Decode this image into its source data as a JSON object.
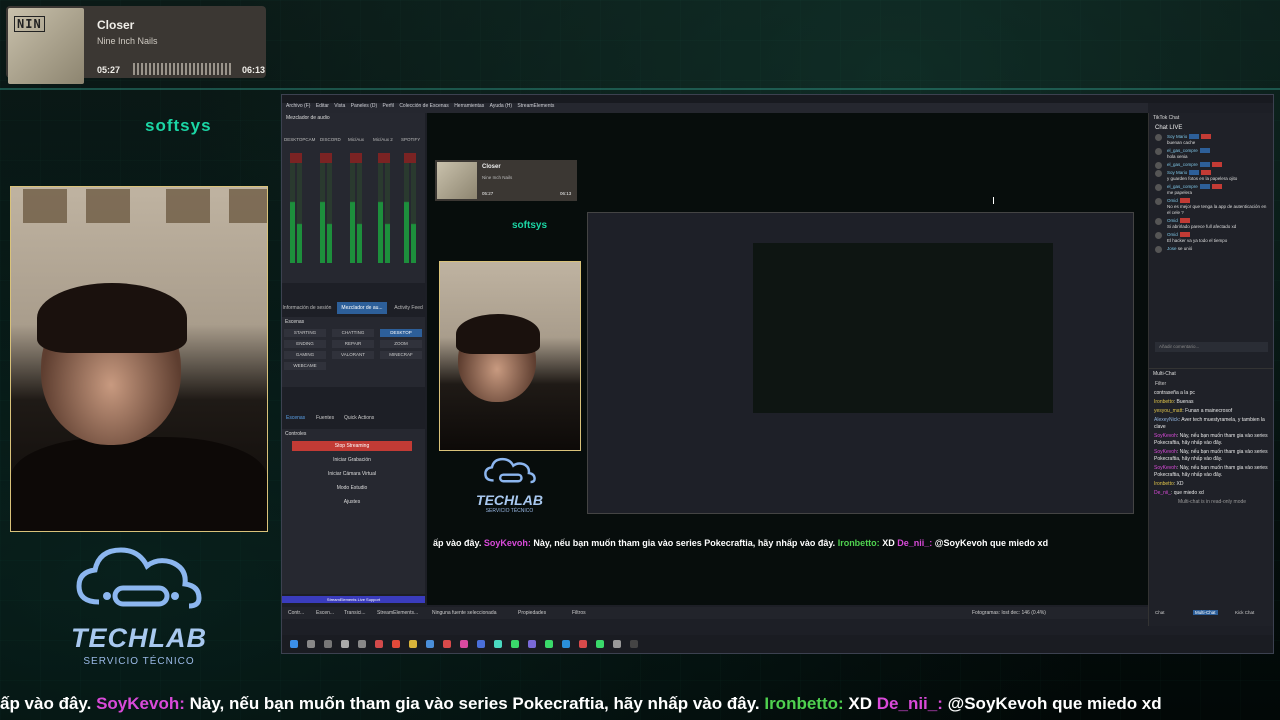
{
  "now_playing": {
    "album_art_logo": "NIN",
    "title": "Closer",
    "artist": "Nine Inch Nails",
    "elapsed": "05:27",
    "duration": "06:13"
  },
  "overlay": {
    "softsys": "softsys",
    "brand_name": "TECHLAB",
    "brand_sub": "SERVICIO TÉCNICO"
  },
  "obs": {
    "menu": [
      "Archivo (F)",
      "Editar",
      "Vista",
      "Paneles (D)",
      "Perfil",
      "Colección de Escenas",
      "Herramientas",
      "Ayuda (H)",
      "StreamElements"
    ],
    "mixer_title": "Mezclador de audio",
    "mixer_channels": [
      "DESKTOPCAM",
      "DISCORD",
      "Mic/Aux",
      "Mic/Aux 2",
      "SPOTIFY"
    ],
    "dock_tabs": [
      "Información de sesión",
      "Mezclador de au...",
      "Activity Feed"
    ],
    "scenes_title": "Escenas",
    "scenes": [
      "STARTING",
      "CHATTING",
      "DESKTOP",
      "ENDING",
      "REPAIR",
      "ZOOM",
      "GAMING",
      "VALORANT",
      "MINECRAF",
      "WEBCAME"
    ],
    "source_tabs": [
      "Escenas",
      "Fuentes",
      "Quick Actions"
    ],
    "controls_title": "Controles",
    "controls": [
      "Stop Streaming",
      "Iniciar Grabación",
      "Iniciar Cámara Virtual",
      "Modo Estudio",
      "Ajustes"
    ],
    "live_support": "StreamElements Live Support",
    "bottom_tabs": [
      "Contr...",
      "Escen...",
      "Transici...",
      "StreamElements..."
    ],
    "status_left": "Ninguna fuente seleccionada",
    "status_props": "Propiedades",
    "status_filters": "Filtros",
    "status_right": "Fotogramas: lost dec: 146 (0.4%)"
  },
  "ticker": {
    "prefix": "ấp vào đây.",
    "user1": "SoyKevoh:",
    "msg1": "Này, nếu bạn muốn tham gia vào series Pokecraftia, hãy nhấp vào đây.",
    "user2": "Ironbetto:",
    "msg2": "XD",
    "user3": "De_nii_:",
    "msg3": "@SoyKevoh que miedo xd"
  },
  "tiktok": {
    "panel_title": "TikTok Chat",
    "live_label": "Chat LIVE",
    "messages": [
      {
        "user": "Soy Mario",
        "text": "buenan cache"
      },
      {
        "user": "el_gas_compre",
        "text": "hola xenia"
      },
      {
        "user": "el_gas_compre",
        "text": ""
      },
      {
        "user": "Soy Mario",
        "text": "y guarden fotos en la papelera ojito"
      },
      {
        "user": "el_gas_compre",
        "text": "me papelera"
      },
      {
        "user": "Omid",
        "text": "No es mejor que tenga la app de autenticación en el cele ?"
      },
      {
        "user": "Omid",
        "text": "Si abrirlado parece full afectado xd"
      },
      {
        "user": "Omid",
        "text": "El hacker va ya todo el tiempo"
      },
      {
        "user": "Jose",
        "text": "se unió"
      }
    ],
    "input_placeholder": "Añadir comentario..."
  },
  "multichat": {
    "panel_title": "Multi-Chat",
    "filter_label": "Filter",
    "messages": [
      {
        "user": "",
        "text": "contraseña a la pc"
      },
      {
        "user": "Ironbetto",
        "text": "Buenas"
      },
      {
        "user": "yesyou_matt",
        "text": "Funan a mainecrosof"
      },
      {
        "user": "AlexeyNick",
        "text": "Aver tech muestyramela, y tambien la clave"
      },
      {
        "user": "SoyKevoh",
        "text": "Này, nếu bạn muốn tham gia vào series Pokecraftia, hãy nhấp vào đây."
      },
      {
        "user": "SoyKevoh",
        "text": "Này, nếu bạn muốn tham gia vào series Pokecraftia, hãy nhấp vào đây."
      },
      {
        "user": "SoyKevoh",
        "text": "Này, nếu bạn muốn tham gia vào series Pokecraftia, hãy nhấp vào đây."
      },
      {
        "user": "Ironbetto",
        "text": "XD"
      },
      {
        "user": "De_nii_",
        "text": "que miedo xd"
      }
    ],
    "readonly_note": "Multi-chat is in read-only mode",
    "tabs": [
      "Chat",
      "Multi-Chat",
      "Kick Chat"
    ]
  },
  "colors": {
    "accent_blue": "#2d5f99",
    "stop_red": "#c23b35",
    "softsys_green": "#1bd6a5",
    "ticker_user": "#d94ad9",
    "ticker_user2": "#4fd14f"
  }
}
